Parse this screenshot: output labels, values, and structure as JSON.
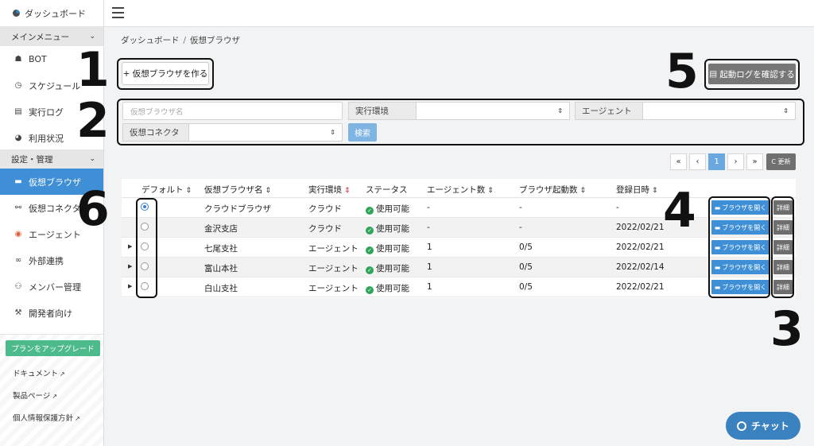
{
  "app": {
    "brand": "ダッシュボード"
  },
  "sidebar": {
    "main_menu_title": "メインメニュー",
    "main_items": [
      {
        "label": "BOT",
        "icon": "robot-icon"
      },
      {
        "label": "スケジュール",
        "icon": "clock-icon"
      },
      {
        "label": "実行ログ",
        "icon": "document-icon"
      },
      {
        "label": "利用状況",
        "icon": "pie-chart-icon"
      }
    ],
    "settings_title": "設定・管理",
    "settings_items": [
      {
        "label": "仮想ブラウザ",
        "icon": "browser-icon",
        "active": true
      },
      {
        "label": "仮想コネクタ",
        "icon": "connector-icon"
      },
      {
        "label": "エージェント",
        "icon": "agent-icon"
      },
      {
        "label": "外部連携",
        "icon": "link-icon"
      },
      {
        "label": "メンバー管理",
        "icon": "users-icon"
      },
      {
        "label": "開発者向け",
        "icon": "wrench-icon"
      }
    ],
    "upgrade_label": "プランをアップグレード",
    "links": [
      "ドキュメント",
      "製品ページ",
      "個人情報保護方針"
    ]
  },
  "breadcrumb": {
    "home": "ダッシュボード",
    "separator": "/",
    "current": "仮想ブラウザ"
  },
  "toolbar": {
    "create_label": "+ 仮想ブラウザを作る",
    "log_label": "起動ログを確認する"
  },
  "filters": {
    "name_placeholder": "仮想ブラウザ名",
    "env_label": "実行環境",
    "agent_label": "エージェント",
    "connector_label": "仮想コネクタ",
    "search_label": "検索"
  },
  "pager": {
    "first": "«",
    "prev": "‹",
    "page": "1",
    "next": "›",
    "last": "»",
    "refresh_label": "C 更新"
  },
  "table": {
    "headers": [
      "デフォルト",
      "仮想ブラウザ名",
      "実行環境",
      "ステータス",
      "エージェント数",
      "ブラウザ起動数",
      "登録日時"
    ],
    "rows": [
      {
        "expandable": false,
        "default": true,
        "name": "クラウドブラウザ",
        "env": "クラウド",
        "status": "使用可能",
        "agents": "-",
        "launches": "-",
        "date": "-"
      },
      {
        "expandable": false,
        "default": false,
        "name": "金沢支店",
        "env": "クラウド",
        "status": "使用可能",
        "agents": "-",
        "launches": "-",
        "date": "2022/02/21"
      },
      {
        "expandable": true,
        "default": false,
        "name": "七尾支社",
        "env": "エージェント",
        "status": "使用可能",
        "agents": "1",
        "launches": "0/5",
        "date": "2022/02/21"
      },
      {
        "expandable": true,
        "default": false,
        "name": "富山本社",
        "env": "エージェント",
        "status": "使用可能",
        "agents": "1",
        "launches": "0/5",
        "date": "2022/02/14"
      },
      {
        "expandable": true,
        "default": false,
        "name": "白山支社",
        "env": "エージェント",
        "status": "使用可能",
        "agents": "1",
        "launches": "0/5",
        "date": "2022/02/21"
      }
    ],
    "open_label": "ブラウザを開く",
    "detail_label": "詳細"
  },
  "annotations": [
    "1",
    "2",
    "3",
    "4",
    "5",
    "6"
  ],
  "chat": {
    "label": "チャット"
  }
}
